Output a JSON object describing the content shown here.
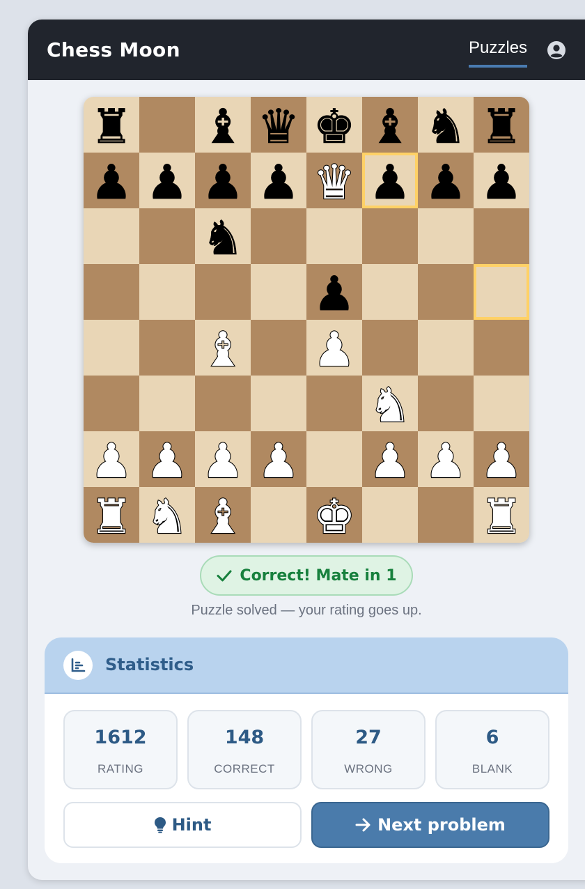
{
  "app": {
    "title": "Chess Moon"
  },
  "nav": {
    "active_tab": "Puzzles",
    "account_icon": "user-circle-icon"
  },
  "board": {
    "orientation": "white-bottom",
    "light_square_color": "#e9d6b6",
    "dark_square_color": "#b08961",
    "highlight_color": "#ffd166",
    "highlighted_squares": [
      "f7",
      "h5"
    ],
    "pieces": [
      "r.bqkbnr",
      "ppppQppp",
      "..n.....",
      "....p...",
      "..B.P...",
      ".....N..",
      "PPPP.PPP",
      "RNB.K..R"
    ]
  },
  "status": {
    "icon": "check-icon",
    "text": "Correct! Mate in 1",
    "subtext": "Puzzle solved — your rating goes up.",
    "color": "#17803d"
  },
  "stats": {
    "icon": "bar-chart-icon",
    "title": "Statistics",
    "items": [
      {
        "value": "1612",
        "label": "RATING"
      },
      {
        "value": "148",
        "label": "CORRECT"
      },
      {
        "value": "27",
        "label": "WRONG"
      },
      {
        "value": "6",
        "label": "BLANK"
      }
    ]
  },
  "actions": {
    "hint_icon": "lightbulb-icon",
    "hint_label": "Hint",
    "next_icon": "arrow-right-icon",
    "next_label": "Next problem"
  },
  "colors": {
    "topbar": "#21252d",
    "accent": "#4a7bab",
    "stats_header": "#b9d3ee"
  }
}
